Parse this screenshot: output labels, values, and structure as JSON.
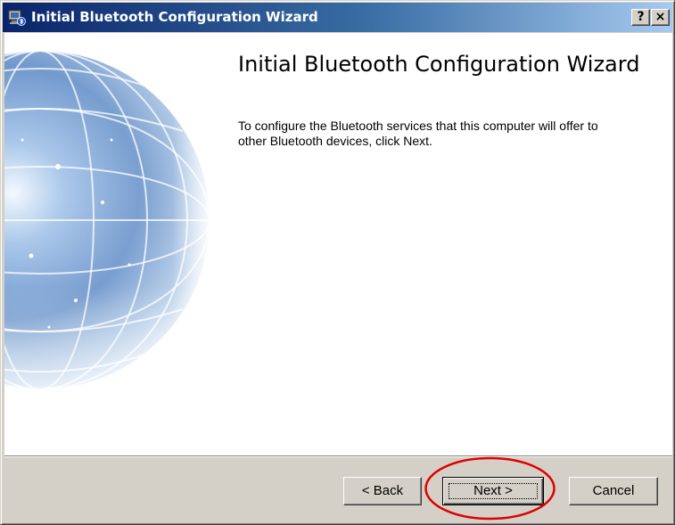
{
  "window": {
    "title": "Initial Bluetooth Configuration Wizard",
    "icon": "bluetooth-computer-icon",
    "help_label": "?",
    "close_label": "×"
  },
  "main": {
    "heading": "Initial Bluetooth Configuration Wizard",
    "description": "To configure the Bluetooth services that this computer will offer to other Bluetooth devices, click Next.",
    "side_image": "globe-illustration"
  },
  "buttons": {
    "back_label": "< Back",
    "next_label": "Next >",
    "cancel_label": "Cancel"
  },
  "annotation": {
    "color": "#e00000",
    "target": "next-button"
  },
  "colors": {
    "title_bar_start": "#0a246a",
    "title_bar_end": "#a6caf0",
    "dialog_face": "#d4d0c8"
  }
}
